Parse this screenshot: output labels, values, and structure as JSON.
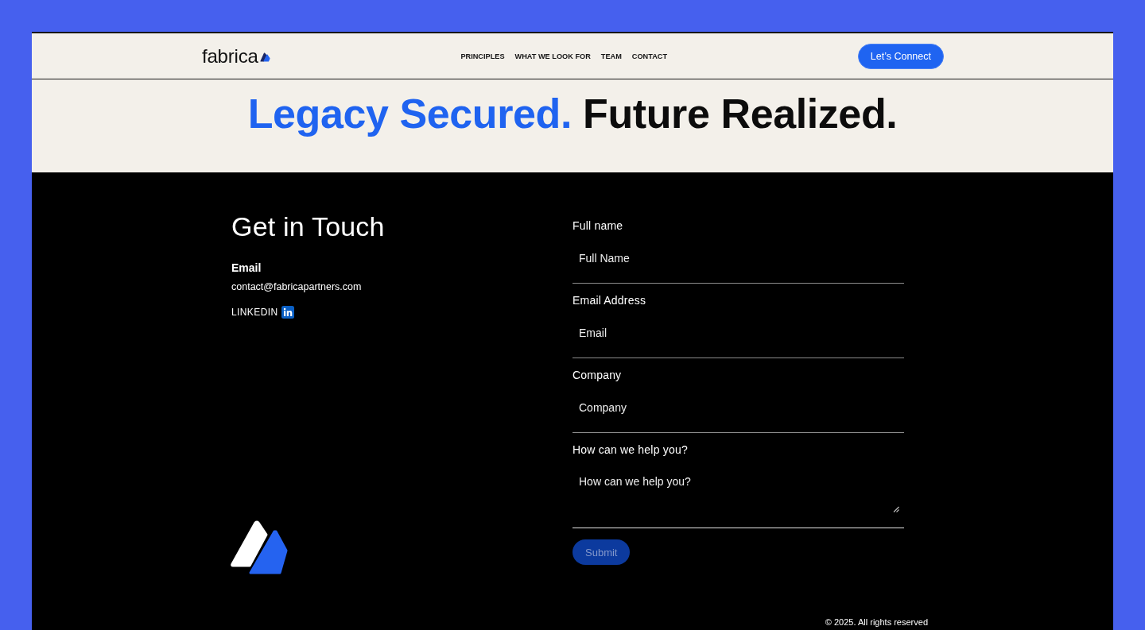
{
  "header": {
    "logo": "fabrica",
    "nav": [
      "PRINCIPLES",
      "WHAT WE LOOK FOR",
      "TEAM",
      "CONTACT"
    ],
    "cta_button": "Let’s Connect"
  },
  "hero": {
    "headline": [
      {
        "text": "Legacy Secured.",
        "kind": "accent"
      },
      {
        "text": "Future Realized.",
        "kind": "plain"
      }
    ]
  },
  "contact": {
    "title": "Get in Touch",
    "email_label": "Email",
    "email": "contact@fabricapartners.com",
    "linkedin": "LINKEDIN"
  },
  "form": {
    "fields": [
      {
        "kind": "input",
        "label": "Full name",
        "placeholder": "Full Name"
      },
      {
        "kind": "input",
        "label": "Email Address",
        "placeholder": "Email"
      },
      {
        "kind": "input",
        "label": "Company",
        "placeholder": "Company"
      },
      {
        "kind": "textarea",
        "label": "How can we help you?",
        "placeholder": "How can we help you?"
      }
    ],
    "submit": {
      "label": "Submit",
      "disabled": true
    }
  },
  "footer": {
    "copyright": "© 2025. All rights reserved"
  }
}
